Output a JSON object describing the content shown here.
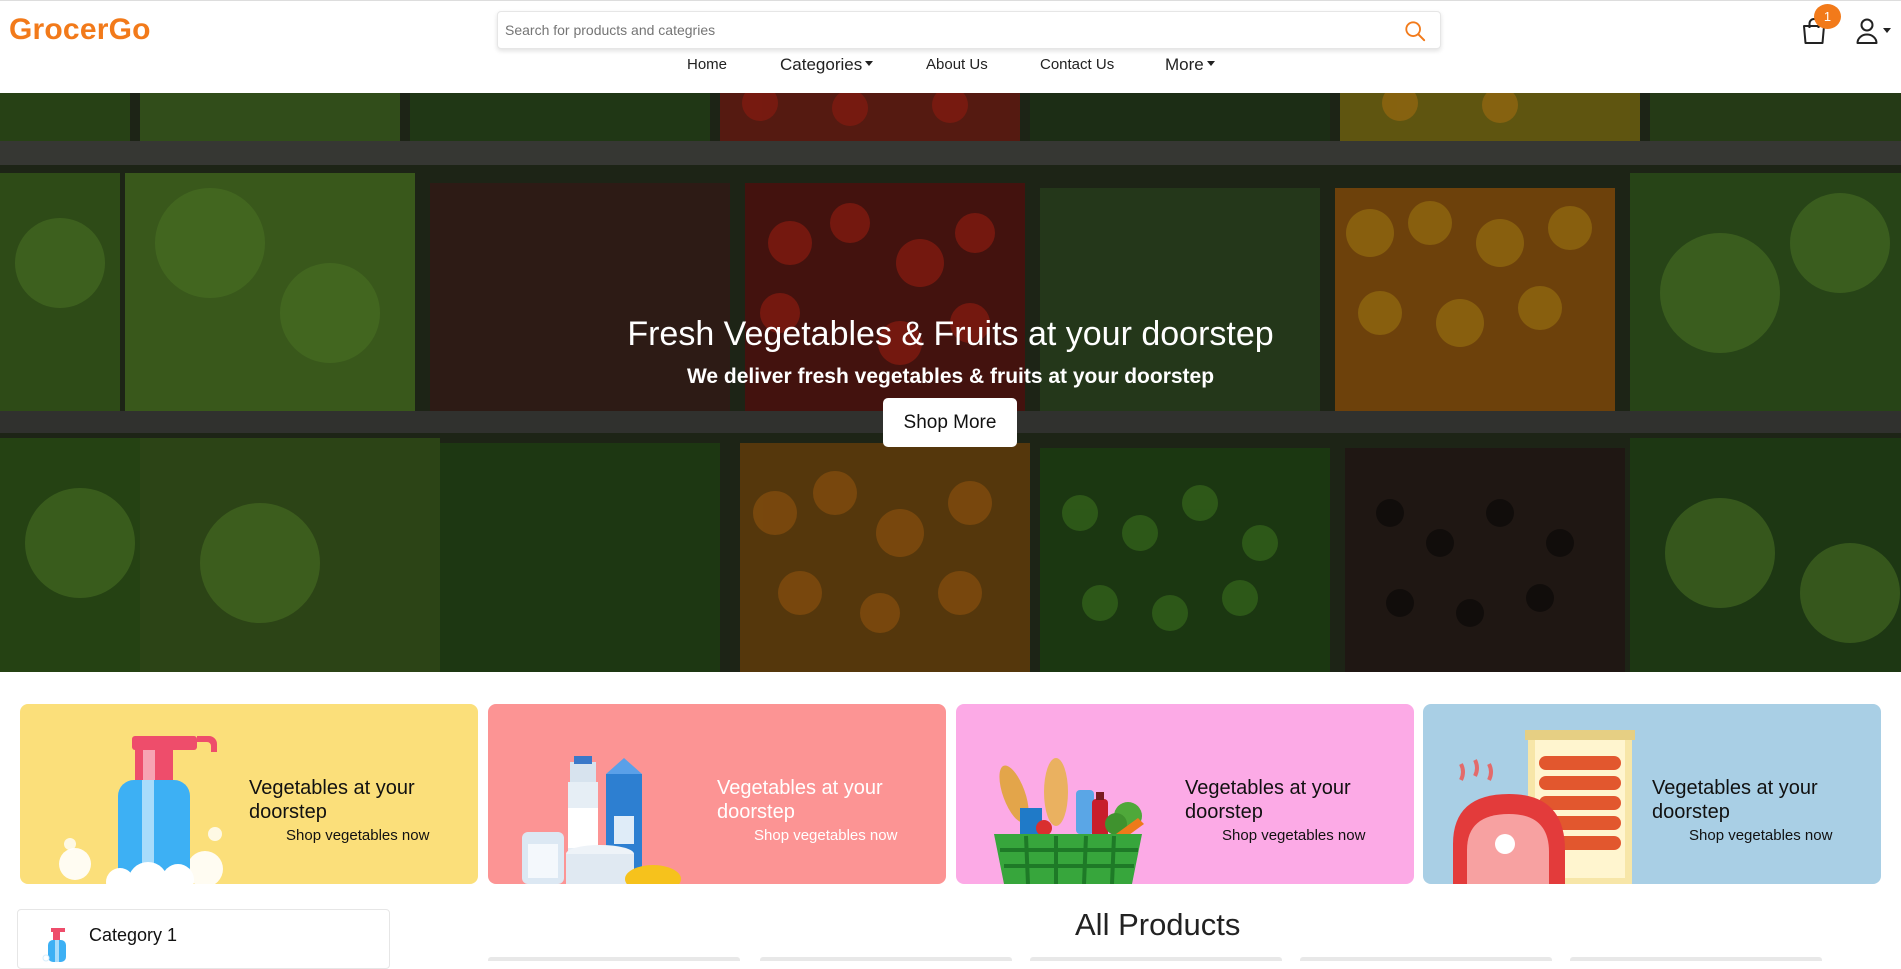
{
  "header": {
    "logo": "GrocerGo",
    "search_placeholder": "Search for products and categries",
    "cart_count": "1",
    "colors": {
      "accent": "#f27a1a"
    }
  },
  "nav": {
    "items": [
      {
        "label": "Home",
        "dropdown": false
      },
      {
        "label": "Categories",
        "dropdown": true
      },
      {
        "label": "About Us",
        "dropdown": false
      },
      {
        "label": "Contact Us",
        "dropdown": false
      },
      {
        "label": "More",
        "dropdown": true
      }
    ]
  },
  "hero": {
    "title": "Fresh Vegetables & Fruits at your doorstep",
    "subtitle": "We deliver fresh vegetables & fruits at your doorstep",
    "button": "Shop More"
  },
  "promos": [
    {
      "title": "Vegetables at your doorstep",
      "subtitle": "Shop vegetables now",
      "bg": "#fbdf7a",
      "illustration": "soap-dispenser-icon"
    },
    {
      "title": "Vegetables at your doorstep",
      "subtitle": "Shop vegetables now",
      "bg": "#fc9494",
      "illustration": "dairy-products-icon"
    },
    {
      "title": "Vegetables at your doorstep",
      "subtitle": "Shop vegetables now",
      "bg": "#fcaae6",
      "illustration": "grocery-basket-icon"
    },
    {
      "title": "Vegetables at your doorstep",
      "subtitle": "Shop vegetables now",
      "bg": "#a9cfe5",
      "illustration": "meat-sausages-icon"
    }
  ],
  "sidebar": {
    "categories": [
      {
        "label": "Category 1",
        "icon": "soap-dispenser-icon"
      }
    ]
  },
  "main": {
    "section_title": "All Products"
  }
}
